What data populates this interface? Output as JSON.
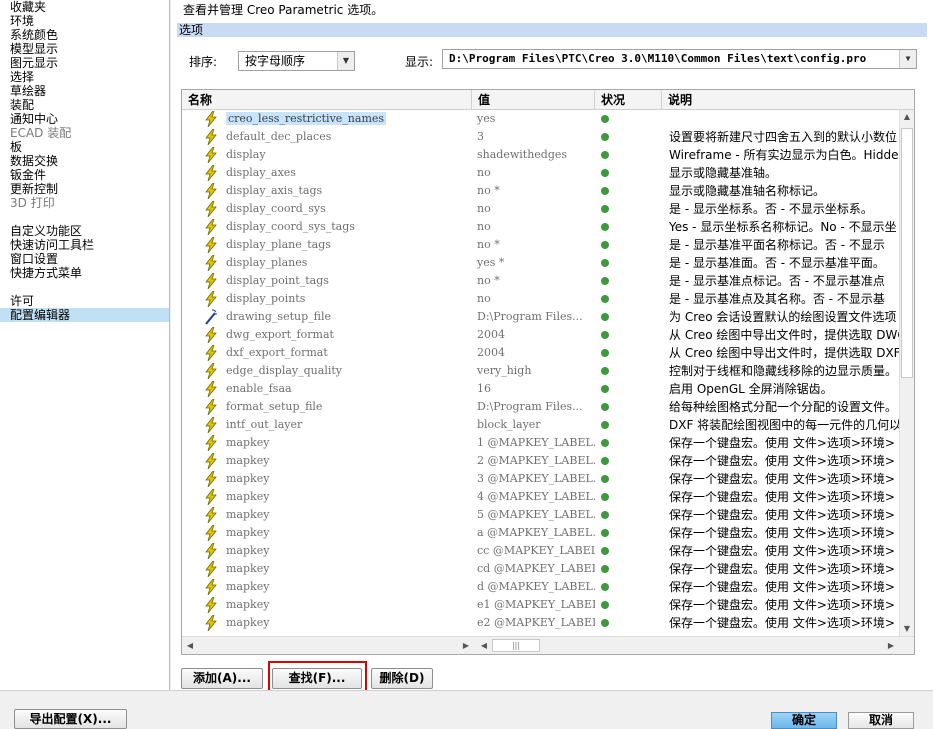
{
  "sidebar": {
    "items": [
      {
        "label": "收藏夹",
        "dim": false,
        "selected": false
      },
      {
        "label": "环境",
        "dim": false,
        "selected": false
      },
      {
        "label": "系统颜色",
        "dim": false,
        "selected": false
      },
      {
        "label": "模型显示",
        "dim": false,
        "selected": false
      },
      {
        "label": "图元显示",
        "dim": false,
        "selected": false
      },
      {
        "label": "选择",
        "dim": false,
        "selected": false
      },
      {
        "label": "草绘器",
        "dim": false,
        "selected": false
      },
      {
        "label": "装配",
        "dim": false,
        "selected": false
      },
      {
        "label": "通知中心",
        "dim": false,
        "selected": false
      },
      {
        "label": "ECAD 装配",
        "dim": true,
        "selected": false
      },
      {
        "label": "板",
        "dim": false,
        "selected": false
      },
      {
        "label": "数据交换",
        "dim": false,
        "selected": false
      },
      {
        "label": "钣金件",
        "dim": false,
        "selected": false
      },
      {
        "label": "更新控制",
        "dim": false,
        "selected": false
      },
      {
        "label": "3D 打印",
        "dim": true,
        "selected": false
      },
      {
        "gap": true
      },
      {
        "label": "自定义功能区",
        "dim": false,
        "selected": false
      },
      {
        "label": "快速访问工具栏",
        "dim": false,
        "selected": false
      },
      {
        "label": "窗口设置",
        "dim": false,
        "selected": false
      },
      {
        "label": "快捷方式菜单",
        "dim": false,
        "selected": false
      },
      {
        "gap": true
      },
      {
        "label": "许可",
        "dim": false,
        "selected": false
      },
      {
        "label": "配置编辑器",
        "dim": false,
        "selected": true
      }
    ]
  },
  "main": {
    "description": "查看并管理 Creo Parametric 选项。",
    "section_title": "选项",
    "sort_label": "排序:",
    "sort_value": "按字母顺序",
    "show_label": "显示:",
    "show_value": "D:\\Program Files\\PTC\\Creo 3.0\\M110\\Common Files\\text\\config.pro"
  },
  "table": {
    "headers": {
      "name": "名称",
      "value": "值",
      "status": "状况",
      "description": "说明"
    },
    "rows": [
      {
        "name": "creo_less_restrictive_names",
        "value": "yes",
        "desc": "",
        "highlight": true,
        "icon": "bolt"
      },
      {
        "name": "default_dec_places",
        "value": "3",
        "desc": "设置要将新建尺寸四舍五入到的默认小数位",
        "icon": "bolt"
      },
      {
        "name": "display",
        "value": "shadewithedges",
        "desc": "Wireframe - 所有实边显示为白色。Hidden",
        "icon": "bolt"
      },
      {
        "name": "display_axes",
        "value": "no",
        "desc": "显示或隐藏基准轴。",
        "icon": "bolt"
      },
      {
        "name": "display_axis_tags",
        "value": "no *",
        "desc": "显示或隐藏基准轴名称标记。",
        "icon": "bolt"
      },
      {
        "name": "display_coord_sys",
        "value": "no",
        "desc": "是 - 显示坐标系。否 - 不显示坐标系。",
        "icon": "bolt"
      },
      {
        "name": "display_coord_sys_tags",
        "value": "no",
        "desc": "Yes - 显示坐标系名称标记。No - 不显示坐",
        "icon": "bolt"
      },
      {
        "name": "display_plane_tags",
        "value": "no *",
        "desc": "是 - 显示基准平面名称标记。否 - 不显示",
        "icon": "bolt"
      },
      {
        "name": "display_planes",
        "value": "yes *",
        "desc": "是 - 显示基准面。否 - 不显示基准平面。",
        "icon": "bolt"
      },
      {
        "name": "display_point_tags",
        "value": "no *",
        "desc": "是 - 显示基准点标记。否 - 不显示基准点",
        "icon": "bolt"
      },
      {
        "name": "display_points",
        "value": "no",
        "desc": "是 - 显示基准点及其名称。否 - 不显示基",
        "icon": "bolt"
      },
      {
        "name": "drawing_setup_file",
        "value": "D:\\Program Files...",
        "desc": "为 Creo 会话设置默认的绘图设置文件选项",
        "icon": "wand"
      },
      {
        "name": "dwg_export_format",
        "value": "2004",
        "desc": "从 Creo 绘图中导出文件时，提供选取 DWG",
        "icon": "bolt"
      },
      {
        "name": "dxf_export_format",
        "value": "2004",
        "desc": "从 Creo 绘图中导出文件时，提供选取 DXF",
        "icon": "bolt"
      },
      {
        "name": "edge_display_quality",
        "value": "very_high",
        "desc": "控制对于线框和隐藏线移除的边显示质量。",
        "icon": "bolt"
      },
      {
        "name": "enable_fsaa",
        "value": "16",
        "desc": "启用 OpenGL 全屏消除锯齿。",
        "icon": "bolt"
      },
      {
        "name": "format_setup_file",
        "value": "D:\\Program Files...",
        "desc": "给每种绘图格式分配一个分配的设置文件。",
        "icon": "bolt"
      },
      {
        "name": "intf_out_layer",
        "value": "block_layer",
        "desc": "DXF 将装配绘图视图中的每一元件的几何以",
        "icon": "bolt"
      },
      {
        "name": "mapkey",
        "value": "1 @MAPKEY_LABEL...",
        "desc": "保存一个键盘宏。使用 文件>选项>环境>",
        "icon": "bolt"
      },
      {
        "name": "mapkey",
        "value": "2 @MAPKEY_LABEL...",
        "desc": "保存一个键盘宏。使用 文件>选项>环境>",
        "icon": "bolt"
      },
      {
        "name": "mapkey",
        "value": "3 @MAPKEY_LABEL...",
        "desc": "保存一个键盘宏。使用 文件>选项>环境>",
        "icon": "bolt"
      },
      {
        "name": "mapkey",
        "value": "4 @MAPKEY_LABEL...",
        "desc": "保存一个键盘宏。使用 文件>选项>环境>",
        "icon": "bolt"
      },
      {
        "name": "mapkey",
        "value": "5 @MAPKEY_LABEL...",
        "desc": "保存一个键盘宏。使用 文件>选项>环境>",
        "icon": "bolt"
      },
      {
        "name": "mapkey",
        "value": "a @MAPKEY_LABEL...",
        "desc": "保存一个键盘宏。使用 文件>选项>环境>",
        "icon": "bolt"
      },
      {
        "name": "mapkey",
        "value": "cc @MAPKEY_LABEL...",
        "desc": "保存一个键盘宏。使用 文件>选项>环境>",
        "icon": "bolt"
      },
      {
        "name": "mapkey",
        "value": "cd @MAPKEY_LABEL...",
        "desc": "保存一个键盘宏。使用 文件>选项>环境>",
        "icon": "bolt"
      },
      {
        "name": "mapkey",
        "value": "d @MAPKEY_LABEL...",
        "desc": "保存一个键盘宏。使用 文件>选项>环境>",
        "icon": "bolt"
      },
      {
        "name": "mapkey",
        "value": "e1 @MAPKEY_LABEL...",
        "desc": "保存一个键盘宏。使用 文件>选项>环境>",
        "icon": "bolt"
      },
      {
        "name": "mapkey",
        "value": "e2 @MAPKEY_LABEL...",
        "desc": "保存一个键盘宏。使用 文件>选项>环境>",
        "icon": "bolt"
      }
    ],
    "hscroll_thumb": "|||"
  },
  "buttons": {
    "add": "添加(A)...",
    "find": "查找(F)...",
    "delete": "删除(D)",
    "export": "导出配置(X)...",
    "ok": "确定",
    "cancel": "取消"
  },
  "colors": {
    "status_ok": "#3c9a3c",
    "highlight_box": "#e00000",
    "section_bar": "#c9daf4"
  }
}
